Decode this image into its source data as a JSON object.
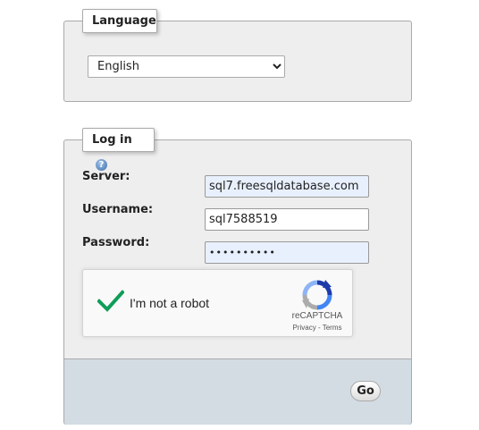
{
  "language_section": {
    "legend": "Language",
    "selected_language": "English",
    "options": [
      "English"
    ]
  },
  "login_section": {
    "legend": "Log in",
    "help_icon": "help-icon",
    "server_label": "Server:",
    "server_value": "sql7.freesqldatabase.com",
    "username_label": "Username:",
    "username_value": "sql7588519",
    "password_label": "Password:",
    "password_masked": "••••••••••",
    "go_label": "Go"
  },
  "captcha": {
    "label": "I'm not a robot",
    "brand": "reCAPTCHA",
    "links": "Privacy - Terms",
    "check_icon": "checkmark-icon",
    "logo_icon": "recaptcha-logo-icon",
    "check_color": "#0f9d58"
  },
  "colors": {
    "panel_bg": "#eeeeee",
    "footer_bg": "#d3dce3",
    "autofill_bg": "#e8f0fe"
  }
}
